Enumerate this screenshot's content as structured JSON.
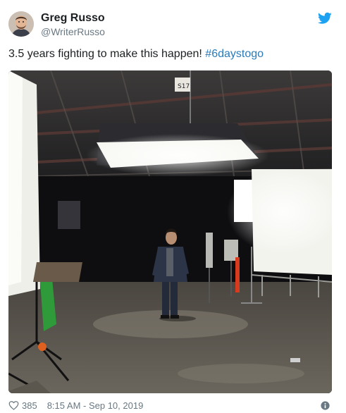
{
  "author": {
    "name": "Greg Russo",
    "handle": "@WriterRusso",
    "avatar_icon": "avatar-photo"
  },
  "tweet": {
    "text": "3.5 years fighting to make this happen!",
    "hashtag": "#6daystogo"
  },
  "media": {
    "sign_text": "S17"
  },
  "footer": {
    "like_count": "385",
    "timestamp": "8:15 AM - Sep 10, 2019"
  },
  "icons": {
    "brand": "twitter-bird-icon",
    "like": "heart-icon",
    "info": "info-icon"
  },
  "colors": {
    "brand": "#1da1f2",
    "hashtag": "#2b7bb9",
    "secondary_text": "#697882"
  }
}
